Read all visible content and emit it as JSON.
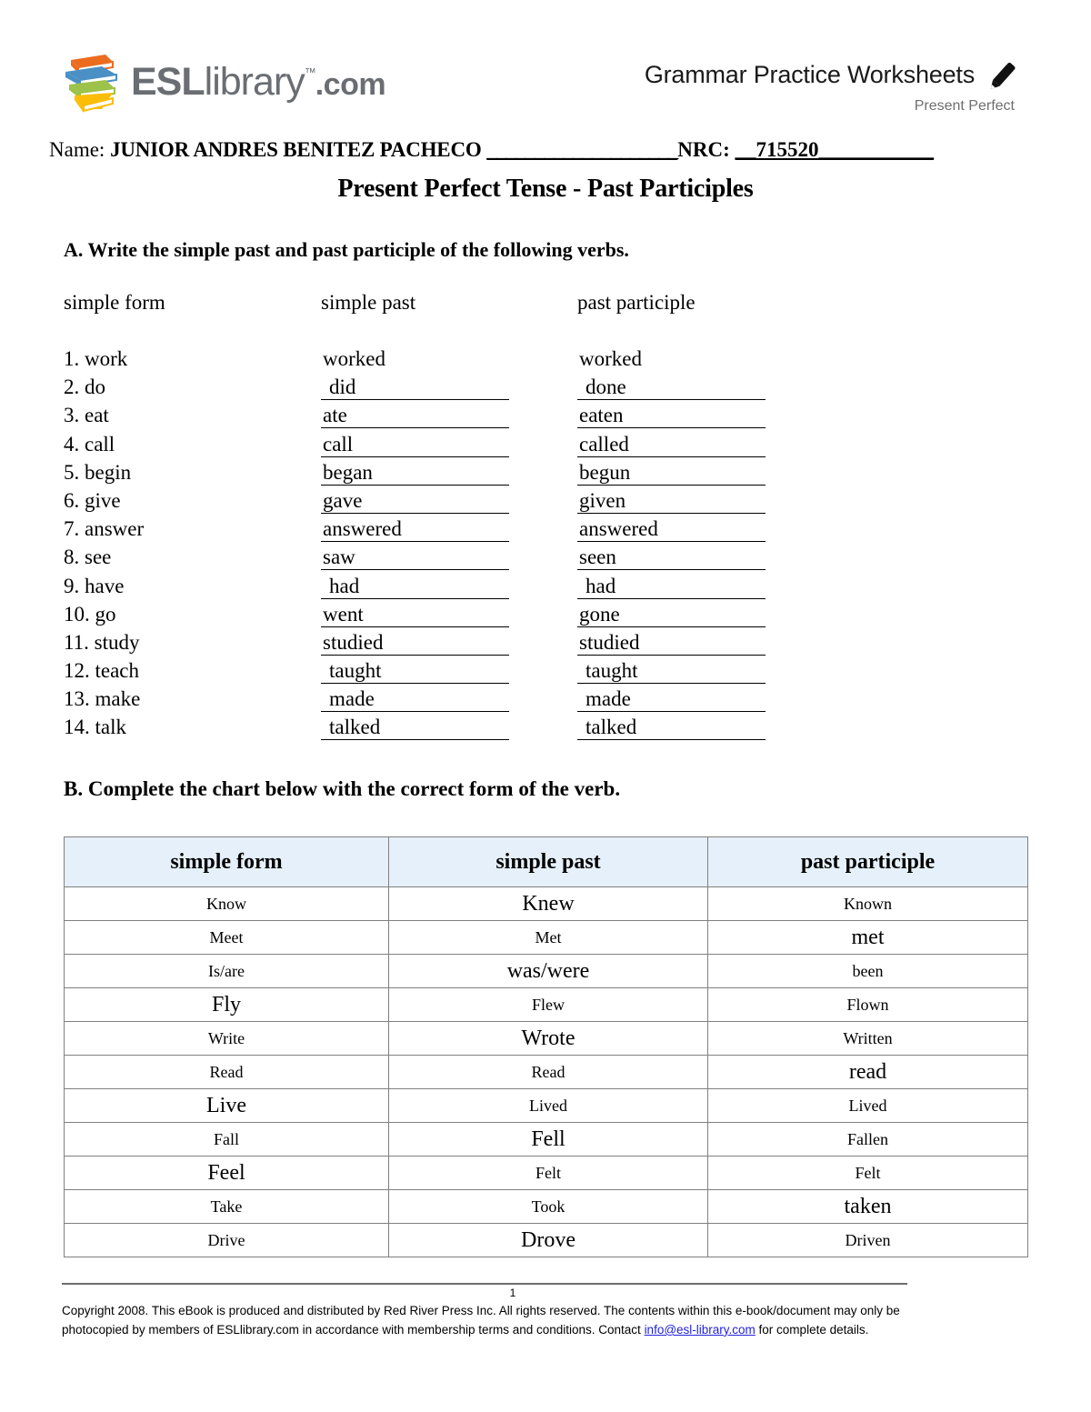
{
  "header": {
    "logo": {
      "icon": "book-stack-icon",
      "text_esl": "ESL",
      "text_library": "library",
      "text_tm": "™",
      "text_com": ".com",
      "book_colors": [
        "#ec6c1f",
        "#4a90c4",
        "#9cc24a",
        "#fbbd08"
      ],
      "text_color": "#6a6e72"
    },
    "worksheet_title": "Grammar Practice Worksheets",
    "worksheet_subtitle": "Present Perfect",
    "pencil_icon": "pencil-icon"
  },
  "name_line": {
    "name_label": "Name:",
    "name_value": "JUNIOR ANDRES BENITEZ PACHECO",
    "name_blank": "____________________",
    "nrc_label": "NRC:",
    "nrc_value": "__715520___________"
  },
  "doc_title": "Present Perfect Tense - Past Participles",
  "section_a": {
    "instruction": "A. Write the simple past and past participle of the following verbs.",
    "columns": [
      "simple form",
      "simple past",
      "past participle"
    ],
    "rows": [
      {
        "num": "1.",
        "simple_form": "work",
        "simple_past": "worked",
        "past_participle": "worked",
        "ruled": false,
        "indent": false
      },
      {
        "num": "2.",
        "simple_form": "do",
        "simple_past": "did",
        "past_participle": "done",
        "ruled": true,
        "indent": true
      },
      {
        "num": "3.",
        "simple_form": "eat",
        "simple_past": "ate",
        "past_participle": "eaten",
        "ruled": true,
        "indent": false
      },
      {
        "num": "4.",
        "simple_form": "call",
        "simple_past": "call",
        "past_participle": "called",
        "ruled": true,
        "indent": false
      },
      {
        "num": "5.",
        "simple_form": "begin",
        "simple_past": "began",
        "past_participle": "begun",
        "ruled": true,
        "indent": false
      },
      {
        "num": "6.",
        "simple_form": "give",
        "simple_past": "gave",
        "past_participle": "given",
        "ruled": true,
        "indent": false
      },
      {
        "num": "7.",
        "simple_form": "answer",
        "simple_past": "answered",
        "past_participle": "answered",
        "ruled": true,
        "indent": false
      },
      {
        "num": "8.",
        "simple_form": "see",
        "simple_past": "saw",
        "past_participle": "seen",
        "ruled": true,
        "indent": false
      },
      {
        "num": "9.",
        "simple_form": "have",
        "simple_past": "had",
        "past_participle": "had",
        "ruled": true,
        "indent": true
      },
      {
        "num": "10.",
        "simple_form": "go",
        "simple_past": "went",
        "past_participle": "gone",
        "ruled": true,
        "indent": false
      },
      {
        "num": "11.",
        "simple_form": "study",
        "simple_past": "studied",
        "past_participle": "studied",
        "ruled": true,
        "indent": false
      },
      {
        "num": "12.",
        "simple_form": "teach",
        "simple_past": "taught",
        "past_participle": "taught",
        "ruled": true,
        "indent": true
      },
      {
        "num": "13.",
        "simple_form": "make",
        "simple_past": "made",
        "past_participle": "made",
        "ruled": true,
        "indent": true
      },
      {
        "num": "14.",
        "simple_form": "talk",
        "simple_past": "talked",
        "past_participle": "talked",
        "ruled": true,
        "indent": true
      }
    ]
  },
  "section_b": {
    "instruction": "B. Complete the chart below with the correct form of the verb.",
    "header_bg": "#e6f0fa",
    "columns": [
      "simple form",
      "simple past",
      "past participle"
    ],
    "rows": [
      {
        "simple_form": "Know",
        "simple_form_size": "s",
        "simple_past": "Knew",
        "simple_past_size": "l",
        "past_participle": "Known",
        "past_participle_size": "s"
      },
      {
        "simple_form": "Meet",
        "simple_form_size": "s",
        "simple_past": "Met",
        "simple_past_size": "s",
        "past_participle": "met",
        "past_participle_size": "l"
      },
      {
        "simple_form": "Is/are",
        "simple_form_size": "s",
        "simple_past": "was/were",
        "simple_past_size": "l",
        "past_participle": "been",
        "past_participle_size": "s"
      },
      {
        "simple_form": "Fly",
        "simple_form_size": "l",
        "simple_past": "Flew",
        "simple_past_size": "s",
        "past_participle": "Flown",
        "past_participle_size": "s"
      },
      {
        "simple_form": "Write",
        "simple_form_size": "s",
        "simple_past": "Wrote",
        "simple_past_size": "l",
        "past_participle": "Written",
        "past_participle_size": "s"
      },
      {
        "simple_form": "Read",
        "simple_form_size": "s",
        "simple_past": "Read",
        "simple_past_size": "s",
        "past_participle": "read",
        "past_participle_size": "l"
      },
      {
        "simple_form": "Live",
        "simple_form_size": "l",
        "simple_past": "Lived",
        "simple_past_size": "s",
        "past_participle": "Lived",
        "past_participle_size": "s"
      },
      {
        "simple_form": "Fall",
        "simple_form_size": "s",
        "simple_past": "Fell",
        "simple_past_size": "l",
        "past_participle": "Fallen",
        "past_participle_size": "s"
      },
      {
        "simple_form": "Feel",
        "simple_form_size": "l",
        "simple_past": "Felt",
        "simple_past_size": "s",
        "past_participle": "Felt",
        "past_participle_size": "s"
      },
      {
        "simple_form": "Take",
        "simple_form_size": "s",
        "simple_past": "Took",
        "simple_past_size": "s",
        "past_participle": "taken",
        "past_participle_size": "l"
      },
      {
        "simple_form": "Drive",
        "simple_form_size": "s",
        "simple_past": "Drove",
        "simple_past_size": "l",
        "past_participle": "Driven",
        "past_participle_size": "s"
      }
    ]
  },
  "footer": {
    "page_number": "1",
    "copyright_part1": "Copyright 2008. This eBook is produced and distributed by Red River Press Inc. All rights reserved. The contents within this e-book/document may only be photocopied by members of ESLlibrary.com in accordance with membership terms and conditions. Contact ",
    "copyright_link": "info@esl-library.com",
    "copyright_part2": " for complete details.",
    "link_color": "#2222dd"
  }
}
